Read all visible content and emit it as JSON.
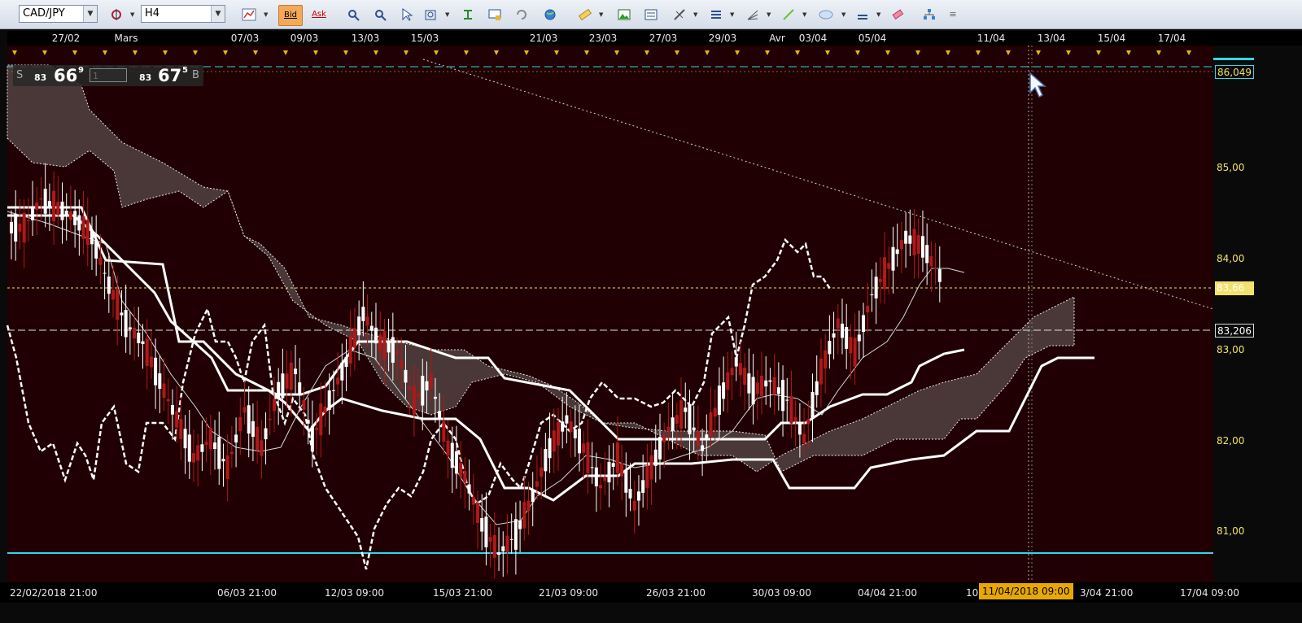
{
  "toolbar": {
    "symbol": "CAD/JPY",
    "timeframe": "H4",
    "bid_label": "Bid",
    "ask_label": "Ask"
  },
  "quote_panel": {
    "sell_label": "S",
    "sell_small": "83",
    "sell_big": "66",
    "sell_sup": "9",
    "lot_value": "1",
    "buy_small": "83",
    "buy_big": "67",
    "buy_sup": "5",
    "buy_label": "B"
  },
  "top_dates": [
    "27/02",
    "Mars",
    "07/03",
    "09/03",
    "13/03",
    "15/03",
    "21/03",
    "23/03",
    "27/03",
    "29/03",
    "Avr",
    "03/04",
    "05/04",
    "11/04",
    "13/04",
    "15/04",
    "17/04"
  ],
  "bottom_dates": [
    "22/02/2018 21:00",
    "06/03 21:00",
    "12/03 09:00",
    "15/03 21:00",
    "21/03 09:00",
    "26/03 21:00",
    "30/03 09:00",
    "04/04 21:00",
    "10",
    "3/04 21:00",
    "17/04 09:00"
  ],
  "hover_date": "11/04/2018 09:00",
  "price_axis": {
    "ticks": [
      "85,00",
      "84,00",
      "83,00",
      "82,00",
      "81,00"
    ],
    "top_marker": "86,049",
    "mid_marker": "83,206",
    "current_marker": "83,66"
  },
  "colors": {
    "chart_bg": "#200002",
    "up_candle": "#ffffff",
    "down_candle": "#b01818",
    "cloud": "#4a3838",
    "support_line": "#34d6e8",
    "axis_text": "#f0e26a",
    "hover_badge": "#e9a800"
  },
  "chart_data": {
    "type": "line",
    "symbol": "CAD/JPY",
    "timeframe": "H4",
    "ylim": [
      80.5,
      86.1
    ],
    "reference_lines": [
      86.049,
      83.206,
      83.66,
      80.75
    ],
    "close_series_approx": [
      84.2,
      84.5,
      84.4,
      84.3,
      84.1,
      83.6,
      83.2,
      83.0,
      82.6,
      82.2,
      81.8,
      82.0,
      81.7,
      82.3,
      81.9,
      82.5,
      82.7,
      82.0,
      82.4,
      82.8,
      83.3,
      83.0,
      82.9,
      82.4,
      82.6,
      81.9,
      81.6,
      81.1,
      80.8,
      81.0,
      81.4,
      81.9,
      82.2,
      81.9,
      81.5,
      81.8,
      81.3,
      81.7,
      82.1,
      82.3,
      81.9,
      82.4,
      82.8,
      82.5,
      82.6,
      82.4,
      82.0,
      82.7,
      83.2,
      82.9,
      83.5,
      83.8,
      84.1,
      84.0,
      83.7
    ]
  }
}
